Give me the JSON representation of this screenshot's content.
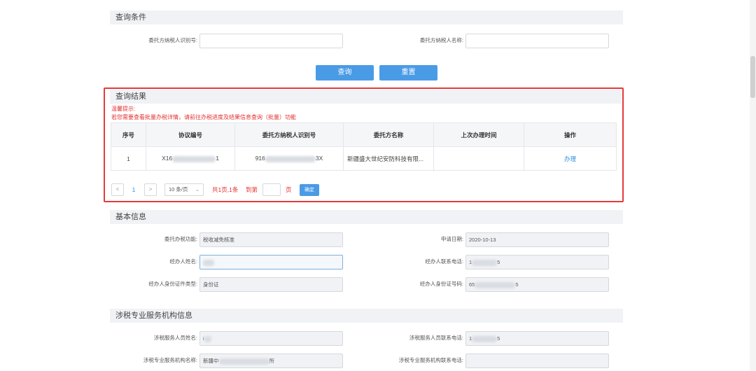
{
  "query": {
    "title": "查询条件",
    "taxpayer_id_label": "委托方纳税人识别号:",
    "taxpayer_name_label": "委托方纳税人名称:",
    "search_button": "查询",
    "reset_button": "重置"
  },
  "results": {
    "title": "查询结果",
    "tip_title": "温馨提示:",
    "tip_text": "若您需要查看批量办税详情，请前往办税进度及结果信息查询（批量）功能",
    "columns": [
      "序号",
      "协议编号",
      "委托方纳税人识别号",
      "委托方名称",
      "上次办理时间",
      "操作"
    ],
    "rows": [
      {
        "index": "1",
        "agreement_prefix": "X16",
        "agreement_suffix": "1",
        "taxpayer_prefix": "916",
        "taxpayer_suffix": "3X",
        "name": "新疆盛大世纪安防科技有限...",
        "last_time": "",
        "action": "办理"
      }
    ],
    "pagination": {
      "prev": "<",
      "page": "1",
      "next": ">",
      "page_size": "10 条/页",
      "summary": "共1页,1条",
      "goto_label": "到第",
      "page_unit": "页",
      "confirm": "确定"
    }
  },
  "basic": {
    "title": "基本信息",
    "function_label": "委托办税功能:",
    "function_value": "税收减免核准",
    "date_label": "申请日期:",
    "date_value": "2020-10-13",
    "agent_name_label": "经办人姓名:",
    "agent_phone_label": "经办人联系电话:",
    "agent_phone_prefix": "1",
    "agent_phone_suffix": "5",
    "id_type_label": "经办人身份证件类型:",
    "id_type_value": "身份证",
    "id_number_label": "经办人身份证号码:",
    "id_number_prefix": "65",
    "id_number_suffix": "5"
  },
  "agency": {
    "title": "涉税专业服务机构信息",
    "staff_name_label": "涉税服务人员姓名:",
    "staff_name_prefix": "i",
    "staff_phone_label": "涉税服务人员联系电话:",
    "staff_phone_prefix": "1",
    "staff_phone_suffix": "5",
    "org_name_label": "涉税专业服务机构名称:",
    "org_name_prefix": "新疆中",
    "org_name_suffix": "所",
    "org_phone_label": "涉税专业服务机构联系电话:"
  },
  "colors": {
    "primary": "#4a9be6",
    "highlight_border": "#e53a3a",
    "tip": "#e3302f",
    "link": "#2d8ce0"
  }
}
